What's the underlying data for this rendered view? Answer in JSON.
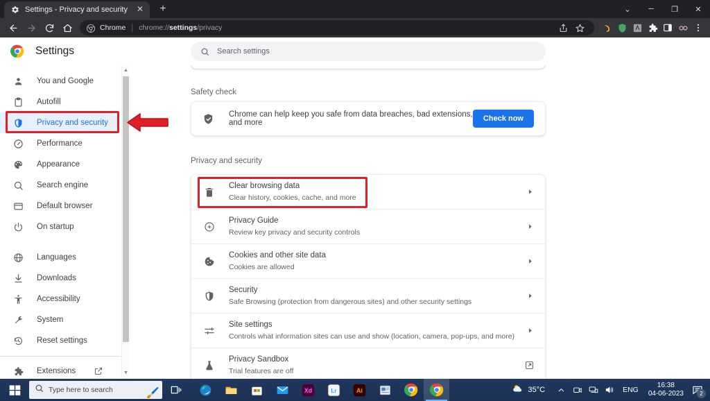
{
  "browser": {
    "tab": {
      "title": "Settings - Privacy and security",
      "favicon_icon": "gear-icon",
      "close_icon": "close-icon"
    },
    "new_tab_label": "+",
    "window_controls": [
      {
        "name": "chevron-down",
        "glyph": "⌄"
      },
      {
        "name": "minimize",
        "glyph": "─"
      },
      {
        "name": "maximize",
        "glyph": "❐"
      },
      {
        "name": "close",
        "glyph": "✕"
      }
    ],
    "nav": {
      "back_icon": "back-arrow-icon",
      "forward_icon": "forward-arrow-icon",
      "reload_icon": "reload-icon",
      "home_icon": "home-icon"
    },
    "omnibox": {
      "scope_label": "Chrome",
      "url_prefix": "chrome://",
      "url_bold": "settings",
      "url_suffix": "/privacy"
    },
    "toolbar_icons": [
      "share-icon",
      "bookmark-star-icon",
      "extension-honey-icon",
      "extension-brave-shield-icon",
      "extension-grammarly-icon",
      "extensions-puzzle-icon",
      "side-panel-icon",
      "extension-infinity-icon",
      "chrome-menu-icon"
    ]
  },
  "settings_header": {
    "logo_icon": "chrome-logo-icon",
    "title": "Settings"
  },
  "search": {
    "icon": "search-icon",
    "placeholder": "Search settings",
    "value": ""
  },
  "sidebar": {
    "scroll_up_icon": "caret-up-icon",
    "scroll_down_icon": "caret-down-icon",
    "items": [
      {
        "label": "You and Google",
        "icon": "person-icon",
        "selected": false
      },
      {
        "label": "Autofill",
        "icon": "clipboard-icon",
        "selected": false
      },
      {
        "label": "Privacy and security",
        "icon": "shield-icon",
        "selected": true
      },
      {
        "label": "Performance",
        "icon": "gauge-icon",
        "selected": false
      },
      {
        "label": "Appearance",
        "icon": "palette-icon",
        "selected": false
      },
      {
        "label": "Search engine",
        "icon": "magnifier-icon",
        "selected": false
      },
      {
        "label": "Default browser",
        "icon": "browser-window-icon",
        "selected": false
      },
      {
        "label": "On startup",
        "icon": "power-icon",
        "selected": false
      }
    ],
    "items2": [
      {
        "label": "Languages",
        "icon": "globe-icon",
        "selected": false
      },
      {
        "label": "Downloads",
        "icon": "download-icon",
        "selected": false
      },
      {
        "label": "Accessibility",
        "icon": "accessibility-icon",
        "selected": false
      },
      {
        "label": "System",
        "icon": "wrench-icon",
        "selected": false
      },
      {
        "label": "Reset settings",
        "icon": "history-icon",
        "selected": false
      }
    ],
    "extensions": {
      "label": "Extensions",
      "icon": "puzzle-icon",
      "external_icon": "external-link-icon"
    }
  },
  "main": {
    "safety_check": {
      "section_label": "Safety check",
      "icon": "shield-check-icon",
      "text": "Chrome can help keep you safe from data breaches, bad extensions, and more",
      "button_label": "Check now"
    },
    "privacy": {
      "section_label": "Privacy and security",
      "rows": [
        {
          "title": "Clear browsing data",
          "subtitle": "Clear history, cookies, cache, and more",
          "icon": "trash-icon",
          "end_icon": "chevron-right-icon",
          "highlighted": true
        },
        {
          "title": "Privacy Guide",
          "subtitle": "Review key privacy and security controls",
          "icon": "compass-icon",
          "end_icon": "chevron-right-icon",
          "highlighted": false
        },
        {
          "title": "Cookies and other site data",
          "subtitle": "Cookies are allowed",
          "icon": "cookie-icon",
          "end_icon": "chevron-right-icon",
          "highlighted": false
        },
        {
          "title": "Security",
          "subtitle": "Safe Browsing (protection from dangerous sites) and other security settings",
          "icon": "shield-icon",
          "end_icon": "chevron-right-icon",
          "highlighted": false
        },
        {
          "title": "Site settings",
          "subtitle": "Controls what information sites can use and show (location, camera, pop-ups, and more)",
          "icon": "sliders-icon",
          "end_icon": "chevron-right-icon",
          "highlighted": false
        },
        {
          "title": "Privacy Sandbox",
          "subtitle": "Trial features are off",
          "icon": "flask-icon",
          "end_icon": "external-link-icon",
          "highlighted": false
        }
      ]
    }
  },
  "annotations": {
    "highlight_color": "#e01f26",
    "sidebar_box_target": "Privacy and security",
    "arrow_icon": "left-block-arrow",
    "row_box_target": "Clear browsing data"
  },
  "taskbar": {
    "start_icon": "windows-start-icon",
    "search": {
      "icon": "search-icon",
      "placeholder": "Type here to search"
    },
    "task_view_icon": "task-view-icon",
    "apps": [
      {
        "name": "microsoft-edge",
        "label": ""
      },
      {
        "name": "file-explorer",
        "label": ""
      },
      {
        "name": "microsoft-store",
        "label": ""
      },
      {
        "name": "mail",
        "label": ""
      },
      {
        "name": "adobe-xd",
        "label": "Xd"
      },
      {
        "name": "adobe-lightroom",
        "label": "Lr"
      },
      {
        "name": "adobe-illustrator",
        "label": "Ai"
      },
      {
        "name": "news",
        "label": ""
      },
      {
        "name": "google-chrome",
        "label": ""
      },
      {
        "name": "google-chrome-active",
        "label": ""
      }
    ],
    "tray": {
      "weather_icon": "partly-cloudy-icon",
      "temperature": "35°C",
      "show_hidden_icon": "chevron-up-icon",
      "camera_icon": "camera-icon",
      "network_icon": "network-icon",
      "volume_icon": "volume-icon",
      "language": "ENG",
      "time": "16:38",
      "date": "04-06-2023",
      "notification_icon": "notification-icon",
      "notification_count": "2"
    }
  }
}
